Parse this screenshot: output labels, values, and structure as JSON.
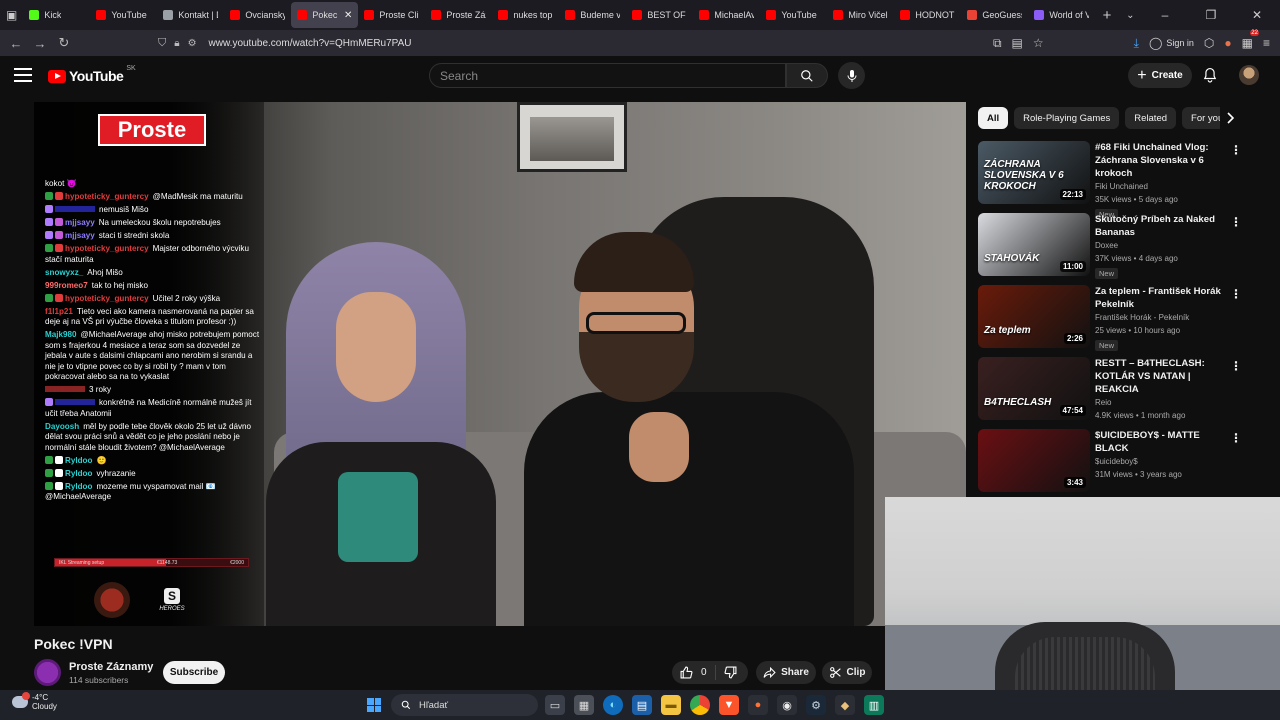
{
  "browser": {
    "tabs": [
      {
        "label": "",
        "color": "#cccccc"
      },
      {
        "label": "Kick",
        "color": "#53fc18"
      },
      {
        "label": "YouTube",
        "color": "#ff0000"
      },
      {
        "label": "Kontakt | D",
        "color": "#9aa0a6"
      },
      {
        "label": "Ovciansky",
        "color": "#ff0000"
      },
      {
        "label": "Pokec !V",
        "color": "#ff0000"
      },
      {
        "label": "Proste Clip",
        "color": "#ff0000"
      },
      {
        "label": "Proste Záz",
        "color": "#ff0000"
      },
      {
        "label": "nukes top",
        "color": "#ff0000"
      },
      {
        "label": "Budeme vo",
        "color": "#ff0000"
      },
      {
        "label": "BEST OF R",
        "color": "#ff0000"
      },
      {
        "label": "MichaelAv",
        "color": "#ff0000"
      },
      {
        "label": "YouTube",
        "color": "#ff0000"
      },
      {
        "label": "Miro Vičel",
        "color": "#ff0000"
      },
      {
        "label": "HODNOTE",
        "color": "#ff0000"
      },
      {
        "label": "GeoGuess",
        "color": "#ea4335"
      },
      {
        "label": "World of V",
        "color": "#8b5cf6"
      }
    ],
    "new_tab": "+",
    "tab_menu": "⌄",
    "window_controls": {
      "minimize": "–",
      "maximize": "❐",
      "close": "✕"
    },
    "url": "www.youtube.com/watch?v=QHmMERu7PAU",
    "sign_in": "Sign in",
    "extension_badge": "22"
  },
  "youtube": {
    "logo_text": "YouTube",
    "country": "SK",
    "search_placeholder": "Search",
    "create_label": "Create"
  },
  "video": {
    "title": "Pokec !VPN",
    "channel": "Proste Záznamy",
    "subscribers": "114 subscribers",
    "subscribe_label": "Subscribe",
    "likes": "0",
    "share_label": "Share",
    "clip_label": "Clip",
    "overlay_logo": "Proste",
    "streaming_setup": {
      "left": "IKL Streaming setup",
      "mid": "€1148.73",
      "right": "€2000",
      "progress": 0.574
    },
    "heroes_text": "HEROES",
    "chat": [
      {
        "user": "",
        "user_color": "#ffffff",
        "text": "kokot 😈",
        "badges": []
      },
      {
        "user": "hypoteticky_guntercy",
        "user_color": "#e23b3b",
        "text": "@MadMesik ma maturitu",
        "badges": [
          "#2ea043",
          "#e23b3b"
        ]
      },
      {
        "user": "",
        "user_color": "#3b3bff",
        "text": "nemusiš Mišo",
        "badges": [
          "#b07cff"
        ]
      },
      {
        "user": "mjjsayy",
        "user_color": "#8e7dff",
        "text": "Na umeleckou školu nepotrebujes",
        "badges": [
          "#b07cff",
          "#c35bd9"
        ]
      },
      {
        "user": "mjjsayy",
        "user_color": "#8e7dff",
        "text": "staci ti stredni skola",
        "badges": [
          "#b07cff",
          "#c35bd9"
        ]
      },
      {
        "user": "hypoteticky_guntercy",
        "user_color": "#e23b3b",
        "text": "Majster odborného výcviku stačí maturita",
        "badges": [
          "#2ea043",
          "#e23b3b"
        ]
      },
      {
        "user": "snowyxz_",
        "user_color": "#2bd1d1",
        "text": "Ahoj Mišo",
        "badges": []
      },
      {
        "user": "999romeo7",
        "user_color": "#ff6b6b",
        "text": "tak to hej misko",
        "badges": []
      },
      {
        "user": "hypoteticky_guntercy",
        "user_color": "#e23b3b",
        "text": "Učitel 2 roky výška",
        "badges": [
          "#2ea043",
          "#e23b3b"
        ]
      },
      {
        "user": "f1l1p21",
        "user_color": "#e23b3b",
        "text": "Tieto veci ako kamera nasmerovaná na papier sa deje aj na VŠ pri výučbe človeka s titulom profesor :))",
        "badges": []
      },
      {
        "user": "Majk980",
        "user_color": "#2bd1d1",
        "text": "@MichaelAverage ahoj misko potrebujem pomoct som s frajerkou 4 mesiace a teraz som sa dozvedel ze jebala v aute s dalsimi chlapcami ano nerobim si srandu a nie je to vtipne povec co by si robil ty ? mam v tom pokracovat alebo sa na to vykaslat",
        "badges": []
      },
      {
        "user": "",
        "user_color": "#e23b3b",
        "text": "3 roky",
        "badges": []
      },
      {
        "user": "",
        "user_color": "#3b3bff",
        "text": "konkrétně na Medicíně normálně mužeš jít učit třeba Anatomii",
        "badges": [
          "#b07cff"
        ]
      },
      {
        "user": "Dayoosh",
        "user_color": "#2bd1d1",
        "text": "měl by podle tebe člověk okolo 25 let už dávno dělat svou práci snů a vědět co je jeho poslání nebo je normální stále bloudit životem? @MichaelAverage",
        "badges": []
      },
      {
        "user": "Ryldoo",
        "user_color": "#2bd1d1",
        "text": "🙂",
        "badges": [
          "#2ea043",
          "#ffffff"
        ]
      },
      {
        "user": "Ryldoo",
        "user_color": "#2bd1d1",
        "text": "vyhrazanie",
        "badges": [
          "#2ea043",
          "#ffffff"
        ]
      },
      {
        "user": "Ryldoo",
        "user_color": "#2bd1d1",
        "text": "mozeme mu vyspamovat mail 📧 @MichaelAverage",
        "badges": [
          "#2ea043",
          "#ffffff"
        ]
      }
    ]
  },
  "sidebar": {
    "chips": [
      "All",
      "Role-Playing Games",
      "Related",
      "For you"
    ],
    "recommendations": [
      {
        "title": "#68 Fiki Unchained Vlog: Záchrana Slovenska v 6 krokoch",
        "channel": "Fiki Unchained",
        "meta": "35K views • 5 days ago",
        "badge": "New",
        "duration": "22:13",
        "thumb_text": "ZÁCHRANA SLOVENSKA V 6 KROKOCH",
        "thumb_color": "#4b5a66"
      },
      {
        "title": "Skutočný Príbeh za Naked Bananas",
        "channel": "Doxee",
        "meta": "37K views • 4 days ago",
        "badge": "New",
        "duration": "11:00",
        "thumb_text": "STAHOVÁK",
        "thumb_color": "#d9dbe0"
      },
      {
        "title": "Za teplem - František Horák Pekelník",
        "channel": "František Horák - Pekelník",
        "meta": "25 views • 10 hours ago",
        "badge": "New",
        "duration": "2:26",
        "thumb_text": "Za teplem",
        "thumb_color": "#6a1b0a"
      },
      {
        "title": "RESTT – B4THECLASH: KOTLÁR VS NATAN | REAKCIA",
        "channel": "Reio",
        "meta": "4.9K views • 1 month ago",
        "badge": "",
        "duration": "47:54",
        "thumb_text": "B4THECLASH",
        "thumb_color": "#3a2020"
      },
      {
        "title": "$UICIDEBOY$ - MATTE BLACK",
        "channel": "$uicideboy$",
        "meta": "31M views • 3 years ago",
        "badge": "",
        "duration": "3:43",
        "thumb_text": "",
        "thumb_color": "#6b0f12"
      }
    ]
  },
  "taskbar": {
    "temperature": "-4°C",
    "weather": "Cloudy",
    "search_placeholder": "Hľadať"
  }
}
